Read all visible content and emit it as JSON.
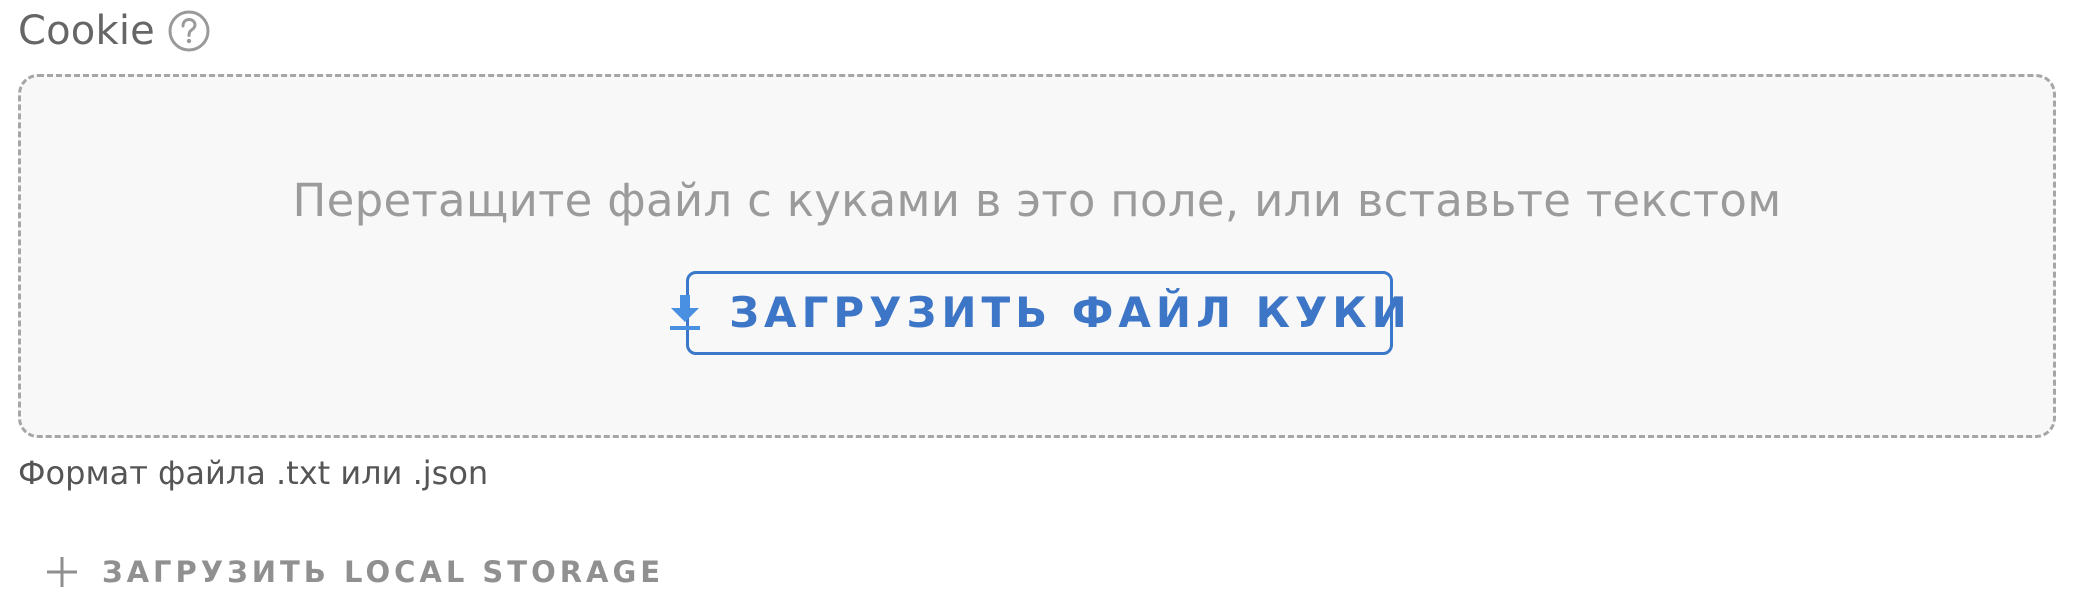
{
  "cookie_field": {
    "label": "Cookie",
    "help_icon": "question-circle-icon",
    "dropzone_hint": "Перетащите файл с куками в это поле, или вставьте текстом",
    "upload_button_label": "ЗАГРУЗИТЬ ФАЙЛ КУКИ",
    "upload_icon": "download-icon",
    "format_note": "Формат файла .txt или .json"
  },
  "local_storage": {
    "button_label": "ЗАГРУЗИТЬ LOCAL STORAGE",
    "icon": "plus-icon"
  },
  "colors": {
    "accent": "#3d76c6",
    "icon_blue": "#4a90e2",
    "label_gray": "#666666",
    "hint_gray": "#9b9b9b",
    "dropzone_bg": "#f8f8f8",
    "dropzone_border": "#a6a6a6"
  }
}
